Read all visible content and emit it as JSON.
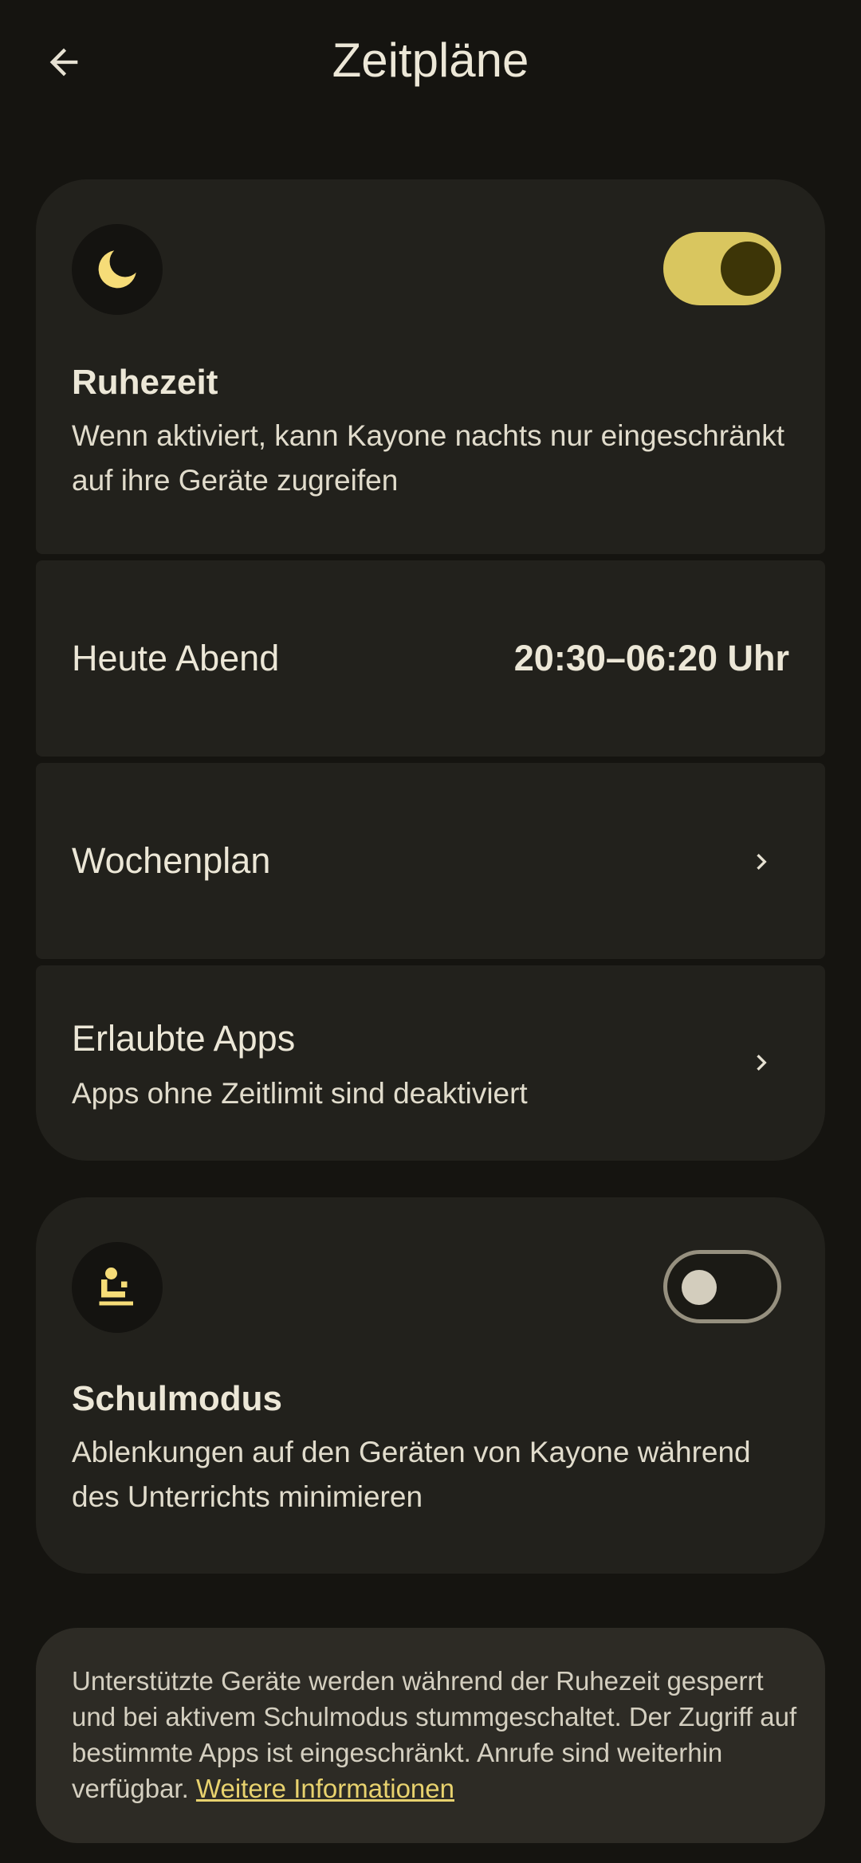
{
  "header": {
    "title": "Zeitpläne",
    "back_icon": "arrow-back-icon"
  },
  "ruhezeit": {
    "icon": "moon-icon",
    "toggle_on": true,
    "title": "Ruhezeit",
    "description": "Wenn aktiviert, kann Kayone nachts nur eingeschränkt auf ihre Geräte zugreifen",
    "tonight_label": "Heute Abend",
    "tonight_value": "20:30–06:20 Uhr",
    "weekly_label": "Wochenplan",
    "allowed_apps_label": "Erlaubte Apps",
    "allowed_apps_sub": "Apps ohne Zeitlimit sind deaktiviert"
  },
  "schulmodus": {
    "icon": "school-desk-icon",
    "toggle_on": false,
    "title": "Schulmodus",
    "description": "Ablenkungen auf den Geräten von Kayone während des Unterrichts minimieren"
  },
  "info": {
    "text": "Unterstützte Geräte werden während der Ruhezeit gesperrt und bei aktivem Schulmodus stummgeschaltet. Der Zugriff auf bestimmte Apps ist eingeschränkt. Anrufe sind weiterhin verfügbar.",
    "link": "Weitere Informationen"
  },
  "colors": {
    "background": "#151410",
    "card": "#22211c",
    "accent": "#d9c65f",
    "link": "#e8d26e"
  }
}
